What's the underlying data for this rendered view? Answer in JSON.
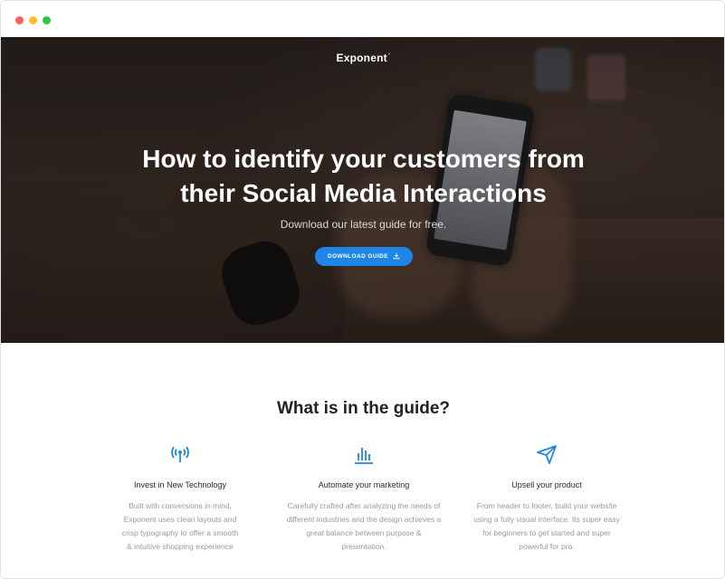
{
  "window": {
    "controls": [
      "close",
      "minimize",
      "maximize"
    ]
  },
  "hero": {
    "brand": "Exponent",
    "brand_mark": "°",
    "title_line1": "How to identify your customers from",
    "title_line2": "their Social Media Interactions",
    "subtitle": "Download our latest guide for free.",
    "download_button": "DOWNLOAD GUIDE",
    "download_icon": "download-icon"
  },
  "guide": {
    "heading": "What is in the guide?",
    "features": [
      {
        "icon": "broadcast-antenna-icon",
        "title": "Invest in New Technology",
        "desc_lines": [
          "Built with conversions in mind,",
          "Exponent uses clean layouts and",
          "crisp typography to offer a smooth",
          "& intuitive shopping experience"
        ]
      },
      {
        "icon": "bar-chart-icon",
        "title": "Automate your marketing",
        "desc_lines": [
          "Carefully crafted after analyzing the needs of",
          "different industries and the design achieves a",
          "great balance between purpose &",
          "presentation."
        ]
      },
      {
        "icon": "paper-plane-icon",
        "title": "Upsell your product",
        "desc_lines": [
          "From header to footer, build your website",
          "using a fully visual interface. Its super easy",
          "for beginners to get started and super",
          "powerful for pro."
        ]
      }
    ]
  },
  "colors": {
    "accent": "#1f86e8",
    "heading": "#222222",
    "body_text": "#9a9a9a"
  }
}
